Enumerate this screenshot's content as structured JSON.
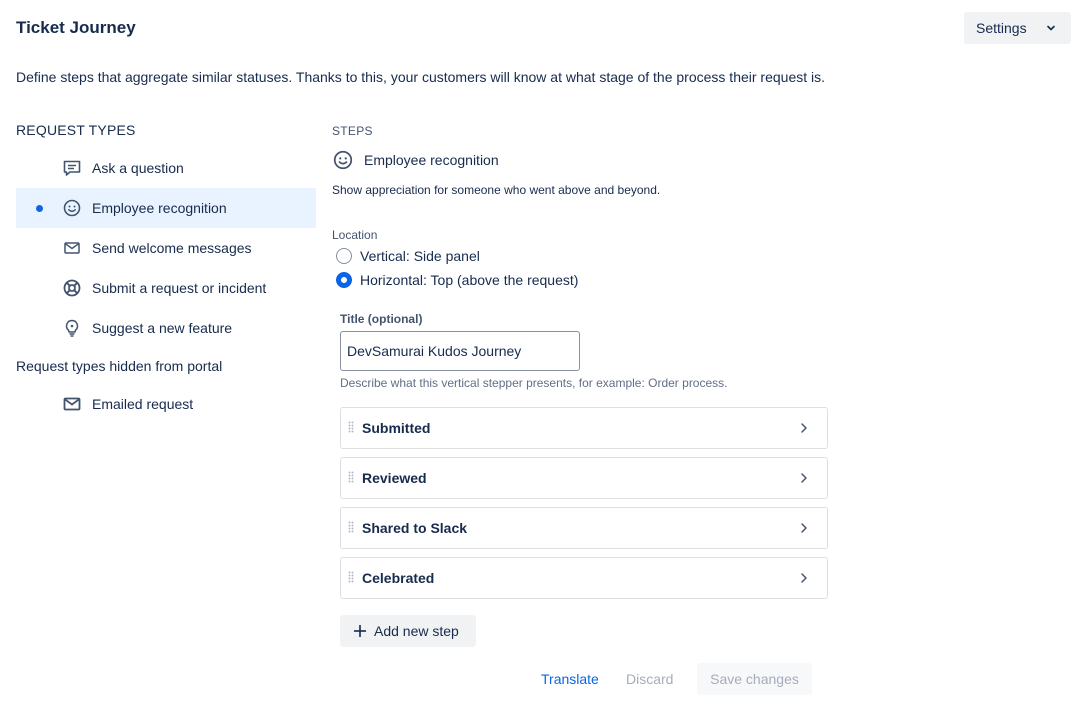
{
  "header": {
    "title": "Ticket Journey",
    "settings_label": "Settings",
    "description": "Define steps that aggregate similar statuses. Thanks to this, your customers will know at what stage of the process their request is."
  },
  "sidebar": {
    "heading": "REQUEST TYPES",
    "items": [
      {
        "label": "Ask a question",
        "icon": "chat-icon"
      },
      {
        "label": "Employee recognition",
        "icon": "smiley-icon",
        "selected": true
      },
      {
        "label": "Send welcome messages",
        "icon": "envelope-icon"
      },
      {
        "label": "Submit a request or incident",
        "icon": "lifebuoy-icon"
      },
      {
        "label": "Suggest a new feature",
        "icon": "lightbulb-icon"
      }
    ],
    "hidden_heading": "Request types hidden from portal",
    "hidden_items": [
      {
        "label": "Emailed request",
        "icon": "envelope-icon"
      }
    ]
  },
  "main": {
    "steps_heading": "STEPS",
    "selected_type": "Employee recognition",
    "selected_description": "Show appreciation for someone who went above and beyond.",
    "location": {
      "label": "Location",
      "options": [
        {
          "label": "Vertical: Side panel",
          "checked": false
        },
        {
          "label": "Horizontal: Top (above the request)",
          "checked": true
        }
      ]
    },
    "title_field": {
      "label": "Title (optional)",
      "value": "DevSamurai Kudos Journey",
      "helper": "Describe what this vertical stepper presents, for example: Order process."
    },
    "steps": [
      {
        "label": "Submitted"
      },
      {
        "label": "Reviewed"
      },
      {
        "label": "Shared to Slack"
      },
      {
        "label": "Celebrated"
      }
    ],
    "add_step_label": "Add new step"
  },
  "footer": {
    "translate_label": "Translate",
    "discard_label": "Discard",
    "save_label": "Save changes"
  },
  "colors": {
    "accent": "#0c66e4",
    "selected_bg": "#e9f2ff",
    "text": "#172b4d",
    "disabled_text": "#a5adba"
  }
}
